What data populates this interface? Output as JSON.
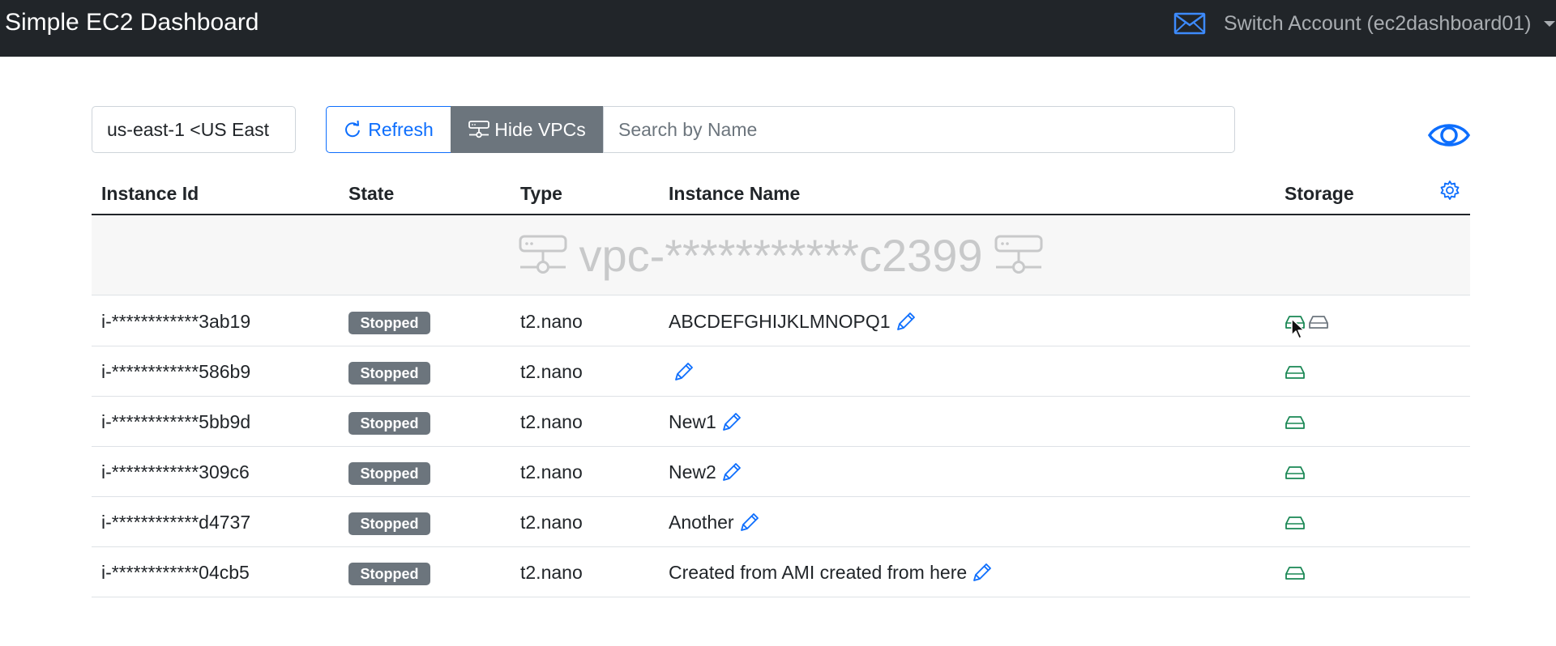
{
  "navbar": {
    "title": "Simple EC2 Dashboard",
    "mail_icon": "envelope-icon",
    "account_label": "Switch Account (ec2dashboard01)"
  },
  "toolbar": {
    "region_value": "us-east-1 <US East",
    "refresh_label": "Refresh",
    "hide_vpcs_label": "Hide VPCs",
    "search_placeholder": "Search by Name",
    "eye_icon": "eye-icon"
  },
  "table": {
    "columns": [
      "Instance Id",
      "State",
      "Type",
      "Instance Name",
      "Storage"
    ],
    "settings_icon": "gear-icon",
    "vpc_label": "vpc-***********c2399",
    "rows": [
      {
        "id": "i-************3ab19",
        "state": "Stopped",
        "type": "t2.nano",
        "name": "ABCDEFGHIJKLMNOPQ1"
      },
      {
        "id": "i-************586b9",
        "state": "Stopped",
        "type": "t2.nano",
        "name": ""
      },
      {
        "id": "i-************5bb9d",
        "state": "Stopped",
        "type": "t2.nano",
        "name": "New1"
      },
      {
        "id": "i-************309c6",
        "state": "Stopped",
        "type": "t2.nano",
        "name": "New2"
      },
      {
        "id": "i-************d4737",
        "state": "Stopped",
        "type": "t2.nano",
        "name": "Another"
      },
      {
        "id": "i-************04cb5",
        "state": "Stopped",
        "type": "t2.nano",
        "name": "Created from AMI created from here"
      }
    ]
  },
  "colors": {
    "navbar_bg": "#212529",
    "accent_blue": "#0d6efd",
    "badge_gray": "#6c757d",
    "disk_green": "#198754"
  }
}
